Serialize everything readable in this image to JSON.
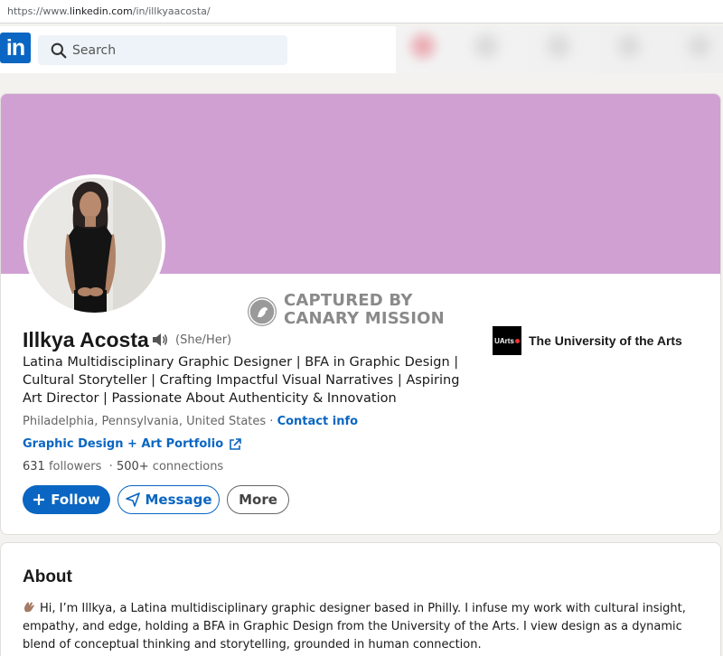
{
  "browser": {
    "url_prefix": "https://www.",
    "url_host": "linkedin.com",
    "url_path": "/in/illkyaacosta/"
  },
  "nav": {
    "logo_text": "in",
    "search_placeholder": "Search"
  },
  "profile": {
    "name": "Illkya Acosta",
    "pronouns": "(She/Her)",
    "headline": "Latina Multidisciplinary Graphic Designer | BFA in Graphic Design | Cultural Storyteller | Crafting Impactful Visual Narratives | Aspiring Art Director | Passionate About Authenticity & Innovation",
    "location": "Philadelphia, Pennsylvania, United States",
    "location_sep": " · ",
    "contact_label": "Contact info",
    "portfolio_label": "Graphic Design + Art Portfolio",
    "followers_count": "631",
    "followers_label": " followers",
    "connections_prefix": "  · ",
    "connections_count": "500+",
    "connections_label": " connections",
    "follow_button": "Follow",
    "message_button": "Message",
    "more_button": "More",
    "organization": {
      "logo_text": "UArts",
      "name": "The University of the Arts"
    },
    "banner_color": "#d0a0d3"
  },
  "watermark": {
    "line1": "CAPTURED BY",
    "line2": "CANARY MISSION"
  },
  "about": {
    "title": "About",
    "text": "Hi, I’m Illkya, a Latina multidisciplinary graphic designer based in Philly. I infuse my work with cultural insight, empathy, and edge, holding a BFA in Graphic Design from the University of the Arts. I view design as a dynamic blend of conceptual thinking and storytelling, grounded in human connection."
  },
  "icons": [
    "search-icon",
    "speaker-icon",
    "external-link-icon",
    "plus-icon",
    "send-icon",
    "wave-emoji-icon",
    "canary-icon"
  ],
  "colors": {
    "brand": "#0a66c2",
    "banner": "#d0a0d3"
  }
}
